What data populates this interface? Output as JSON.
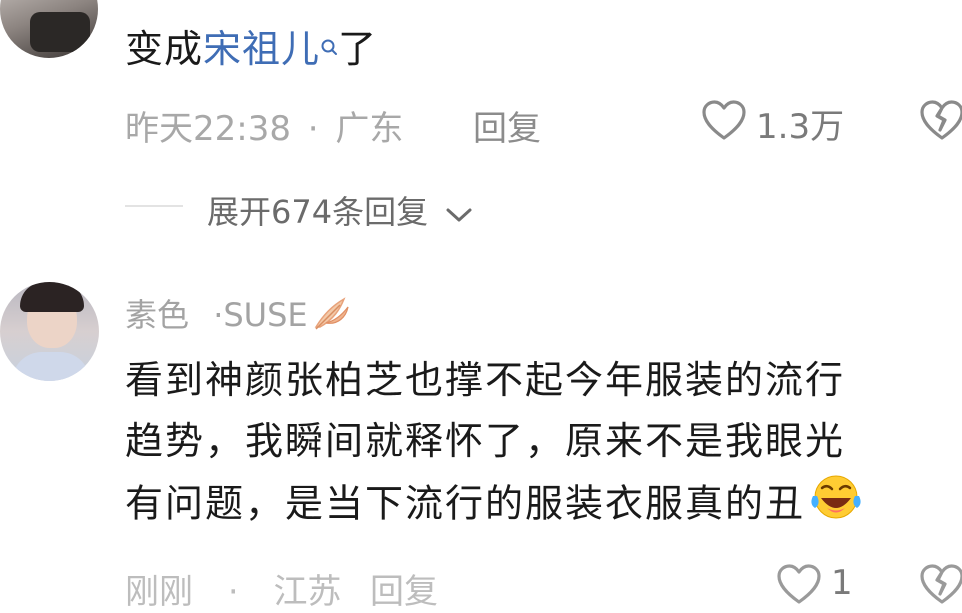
{
  "comment1": {
    "text_prefix": "变成",
    "mention": "宋祖儿",
    "text_suffix": "了",
    "time": "昨天22:38",
    "dot": "·",
    "location": "广东",
    "reply_label": "回复",
    "like_count": "1.3万",
    "expand_label": "展开674条回复"
  },
  "comment2": {
    "username": "素色",
    "dot": "·",
    "username_suffix": "SUSE",
    "lines": [
      "看到神颜张柏芝也撑不起今年服装的流行",
      "趋势，我瞬间就释怀了，原来不是我眼光",
      "有问题，是当下流行的服装衣服真的丑"
    ],
    "time": "刚刚",
    "location": "江苏",
    "reply_label": "回复",
    "like_count": "1"
  },
  "icons": {
    "search": "search-icon",
    "like": "heart-outline-icon",
    "dislike": "broken-heart-icon",
    "expand": "chevron-down-icon",
    "leaf": "maple-leaf-icon",
    "emoji": "laughing-crying-emoji"
  }
}
